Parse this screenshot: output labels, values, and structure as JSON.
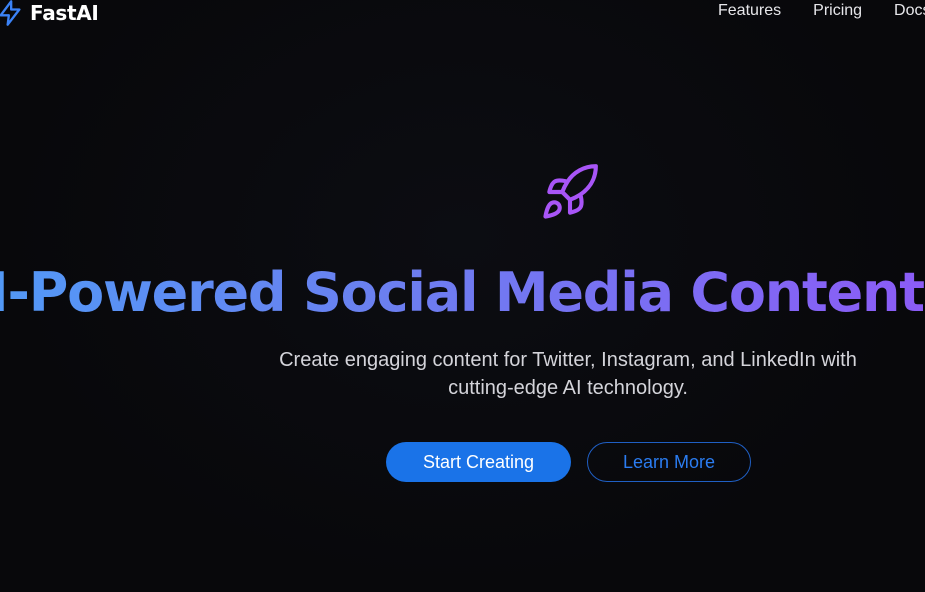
{
  "header": {
    "brand_name": "FastAI",
    "brand_icon": "lightning-bolt-icon",
    "nav": [
      {
        "label": "Features"
      },
      {
        "label": "Pricing"
      },
      {
        "label": "Docs"
      }
    ]
  },
  "hero": {
    "icon": "rocket-icon",
    "title": "AI-Powered Social Media Content",
    "subtitle": "Create engaging content for Twitter, Instagram, and LinkedIn with cutting-edge AI technology.",
    "primary_cta": "Start Creating",
    "secondary_cta": "Learn More"
  },
  "colors": {
    "background": "#08080b",
    "accent_blue": "#1a73e8",
    "gradient_start": "#4f9cf7",
    "gradient_end": "#8b5cf6",
    "rocket": "#a855f7"
  }
}
